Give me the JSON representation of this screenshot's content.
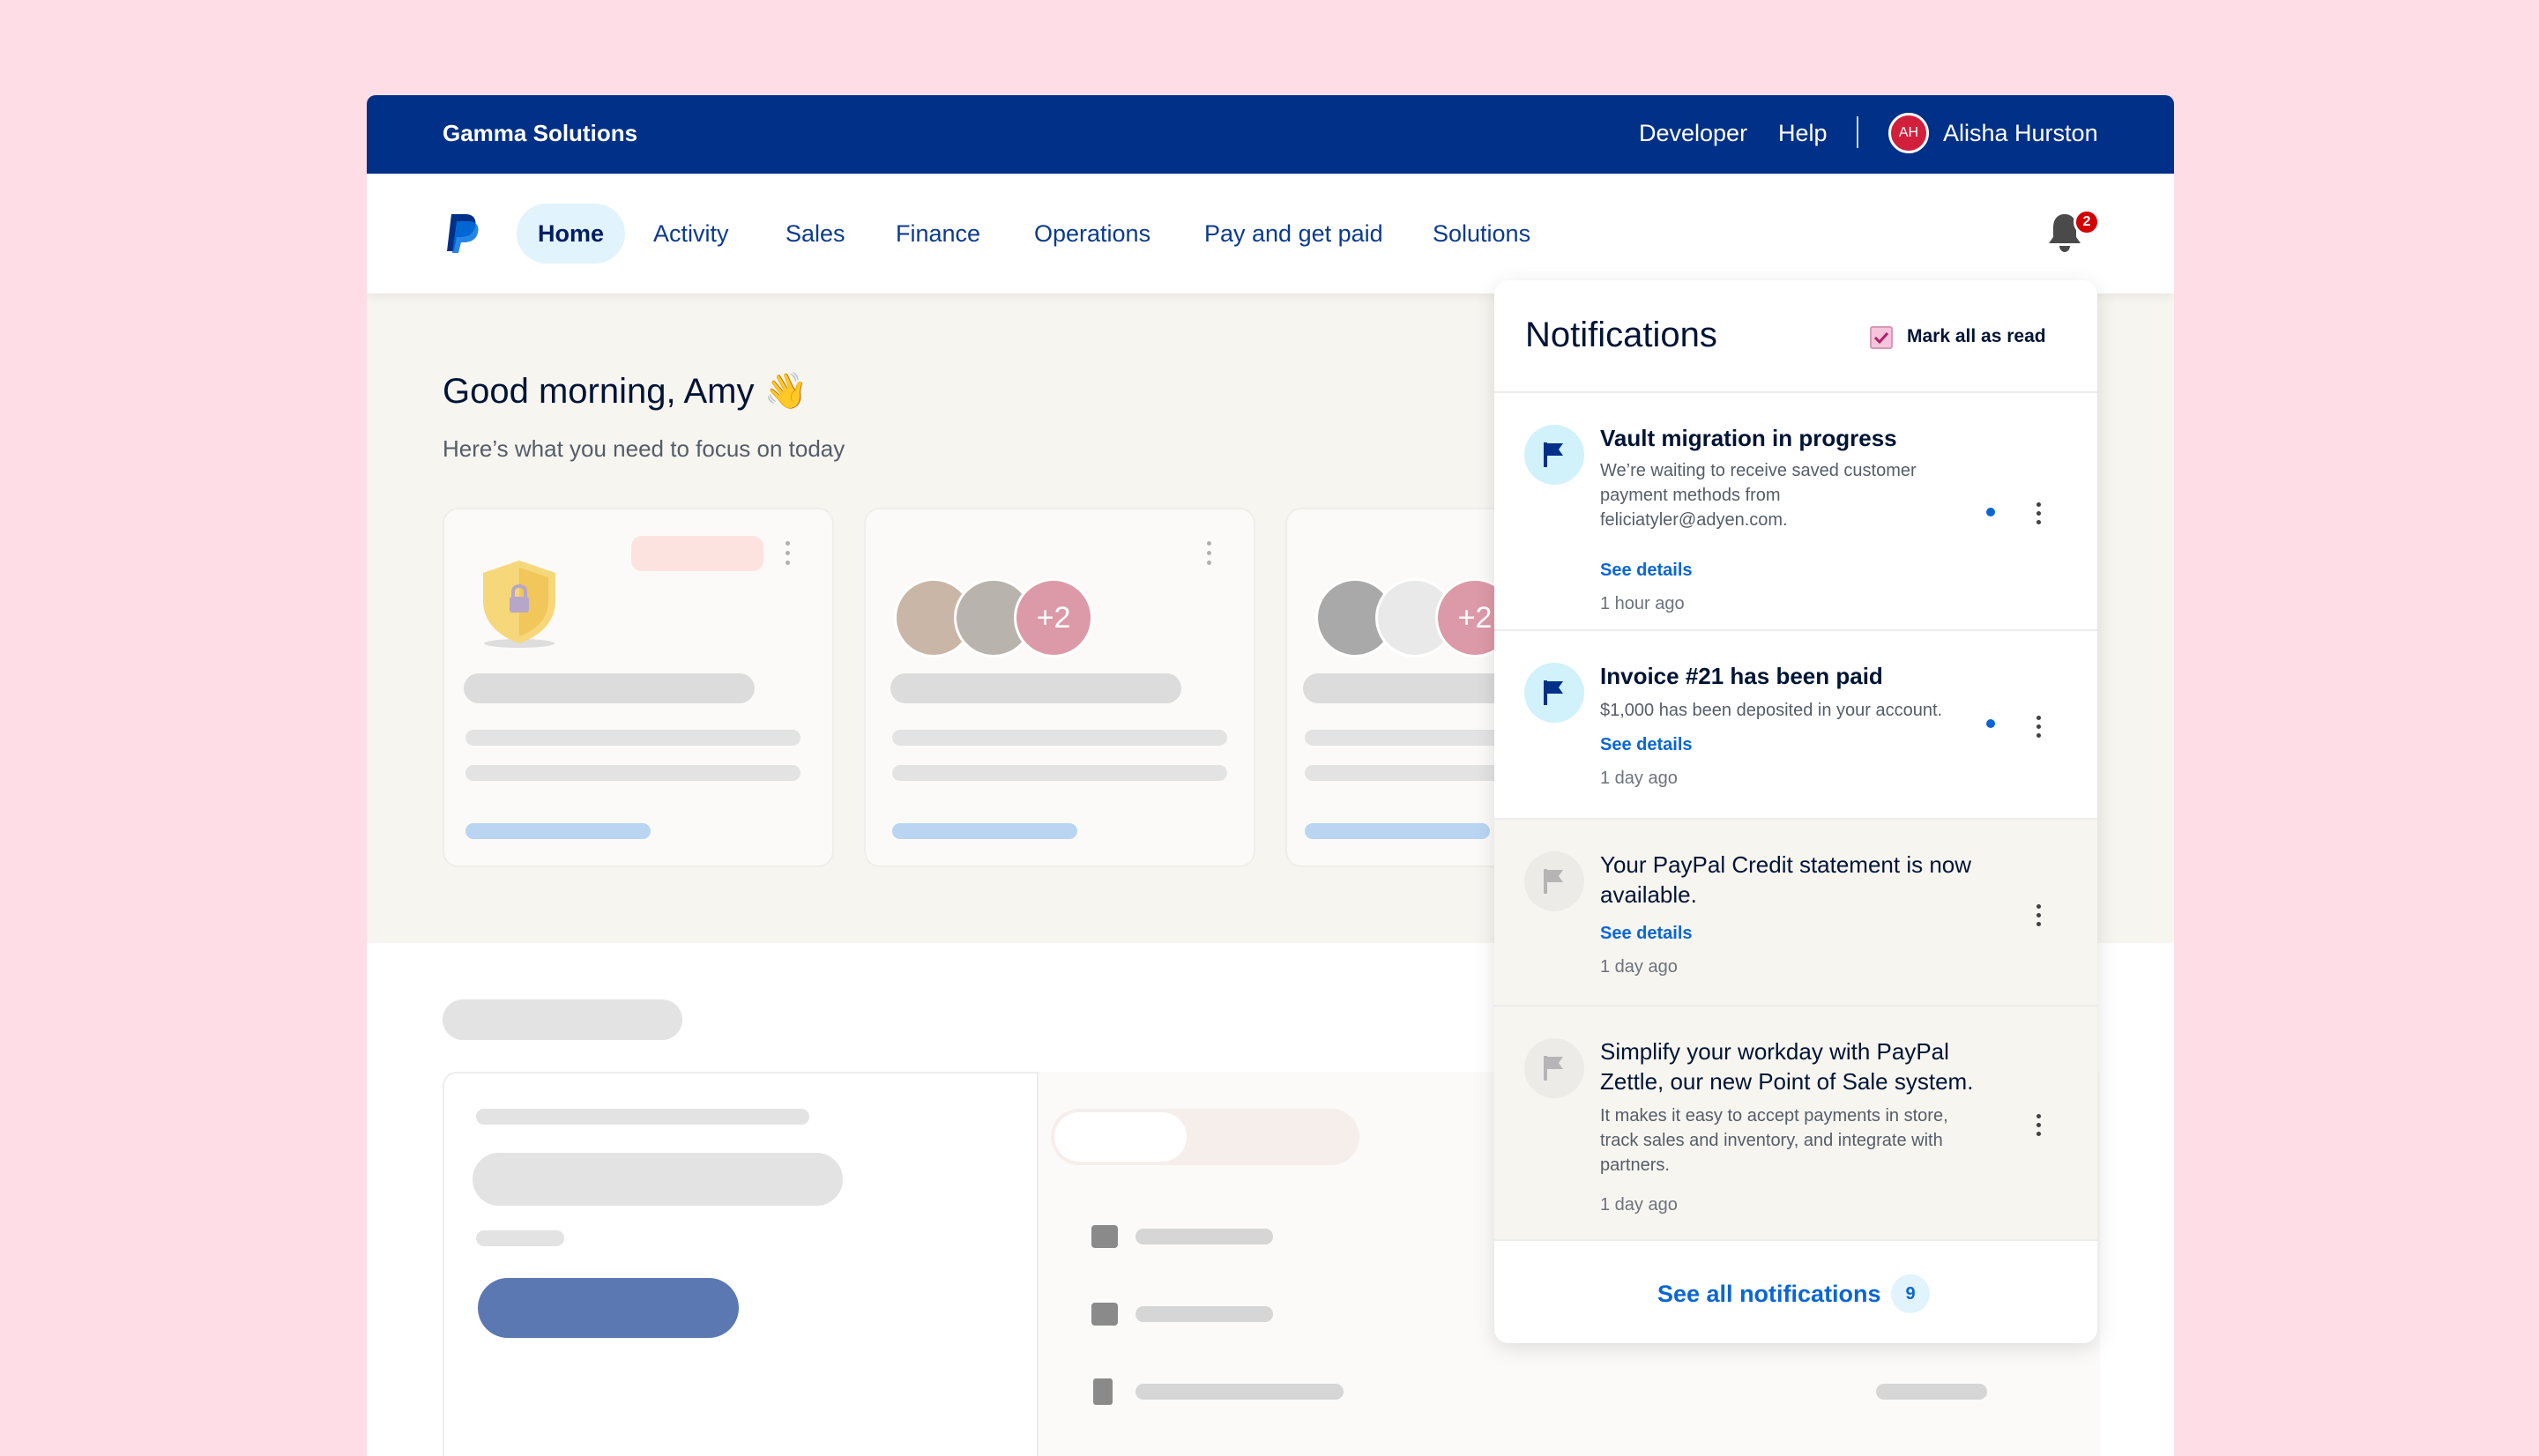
{
  "topbar": {
    "brand": "Gamma Solutions",
    "links": [
      "Developer",
      "Help"
    ],
    "avatar_initials": "AH",
    "user_name": "Alisha Hurston"
  },
  "nav": {
    "items": [
      "Home",
      "Activity",
      "Sales",
      "Finance",
      "Operations",
      "Pay and get paid",
      "Solutions"
    ],
    "active": "Home",
    "bell_count": "2"
  },
  "greeting": {
    "title": "Good morning, Amy 👋",
    "subtitle": "Here’s what you need to focus on today"
  },
  "cards": {
    "avatar_overflow": [
      "+2",
      "+2"
    ]
  },
  "notifications": {
    "title": "Notifications",
    "mark_all": "Mark all as read",
    "items": [
      {
        "title": "Vault migration in progress",
        "body": "We’re waiting to receive saved customer payment methods from feliciatyler@adyen.com.",
        "link": "See details",
        "time": "1 hour ago",
        "unread": true
      },
      {
        "title": "Invoice #21 has been paid",
        "body": "$1,000 has been deposited in your account.",
        "link": "See details",
        "time": "1 day ago",
        "unread": true
      },
      {
        "title": "Your PayPal Credit statement is now available.",
        "body": "",
        "link": "See details",
        "time": "1 day ago",
        "unread": false
      },
      {
        "title": "Simplify your workday with PayPal Zettle, our new Point of Sale system.",
        "body": "It makes it easy to accept payments in store, track sales and inventory, and integrate with partners.",
        "link": "",
        "time": "1 day ago",
        "unread": false
      }
    ],
    "see_all": "See all notifications",
    "see_all_count": "9"
  },
  "colors": {
    "page_bg": "#ffdde7",
    "topbar": "#003087",
    "accent": "#0a66d4",
    "badge": "#d20000"
  }
}
